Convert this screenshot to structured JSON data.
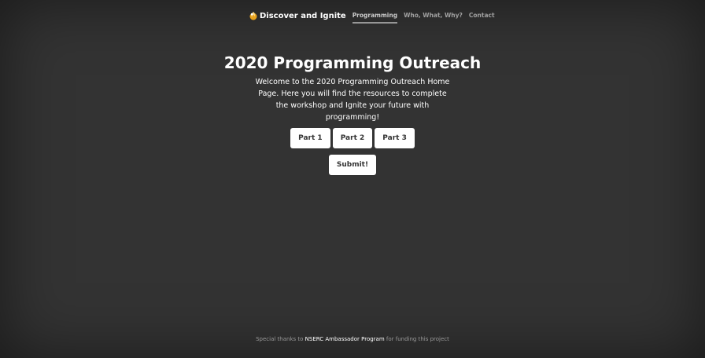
{
  "nav": {
    "brand": {
      "icon": "flame-logo-icon",
      "label": "Discover and Ignite"
    },
    "links": [
      {
        "label": "Programming",
        "active": true
      },
      {
        "label": "Who, What, Why?",
        "active": false
      },
      {
        "label": "Contact",
        "active": false
      }
    ]
  },
  "main": {
    "title": "2020 Programming Outreach",
    "lead": "Welcome to the 2020 Programming Outreach Home Page. Here you will find the resources to complete the workshop and Ignite your future with programming!",
    "parts": [
      "Part 1",
      "Part 2",
      "Part 3"
    ],
    "submit_label": "Submit!"
  },
  "footer": {
    "prefix": "Special thanks to",
    "link": "NSERC Ambassador Program",
    "suffix": "for funding this project"
  },
  "colors": {
    "background": "#333333",
    "button_bg": "#ffffff",
    "button_text": "#333333",
    "brand_icon": "#e8a21b"
  }
}
